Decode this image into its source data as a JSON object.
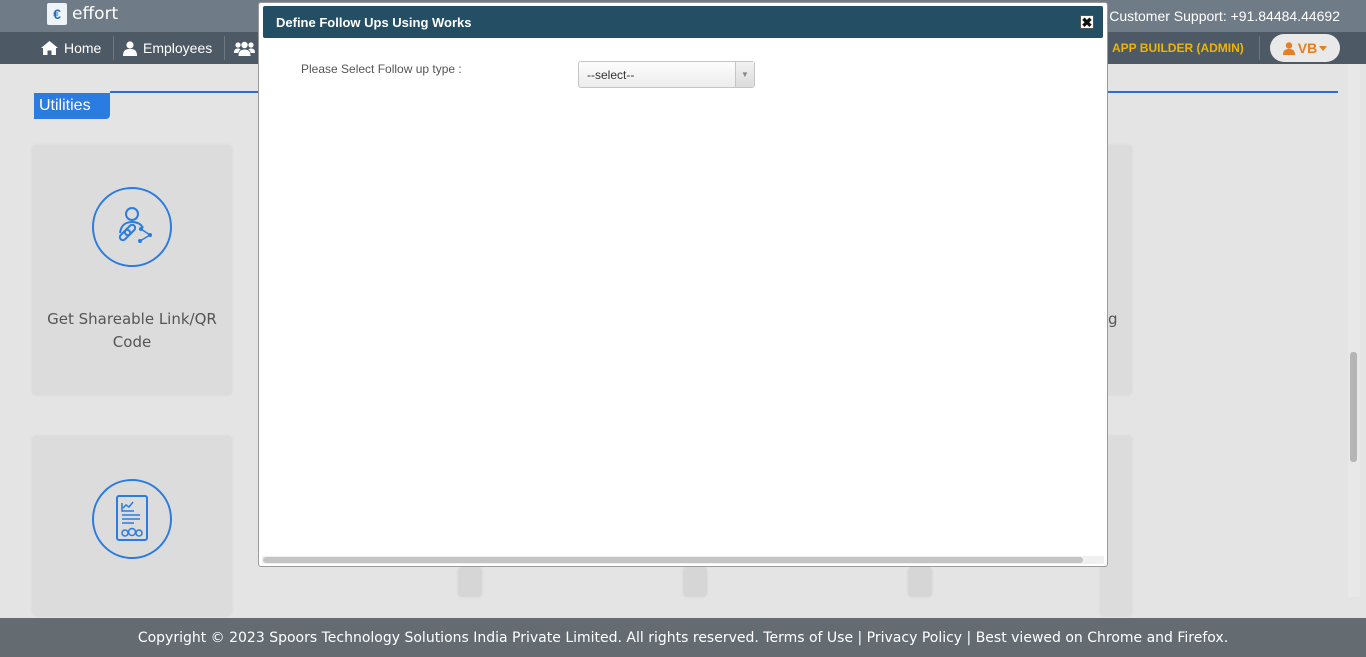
{
  "brand": {
    "name": "effort",
    "logo_glyph": "€"
  },
  "header": {
    "support_text": "Customer Support: +91.84484.44692"
  },
  "nav": {
    "items": [
      {
        "label": "Home",
        "icon": "home-icon"
      },
      {
        "label": "Employees",
        "icon": "user-icon"
      },
      {
        "label": "",
        "icon": "users-group-icon"
      }
    ],
    "app_builder": "APP BUILDER (ADMIN)",
    "user_initials": "VB"
  },
  "section": {
    "title": "Utilities"
  },
  "cards": [
    {
      "label": "Get Shareable Link/QR Code",
      "icon": "shareable-link-icon"
    },
    {
      "label": "",
      "icon": "report-settings-icon"
    }
  ],
  "partial_text": {
    "card_right_fragment": "g"
  },
  "modal": {
    "title": "Define Follow Ups Using Works",
    "close_glyph": "✖",
    "field_label": "Please Select Follow up type :",
    "select_value": "--select--"
  },
  "footer": {
    "text": "Copyright © 2023 Spoors Technology Solutions India Private Limited. All rights reserved. Terms of Use | Privacy Policy | Best viewed on Chrome and Firefox."
  },
  "colors": {
    "accent": "#2b7ce0",
    "header_bg": "#6f7b86",
    "nav_bg": "#4d5964",
    "modal_header_bg": "#234e63",
    "app_builder": "#f0b400",
    "user_badge": "#e67e22"
  }
}
